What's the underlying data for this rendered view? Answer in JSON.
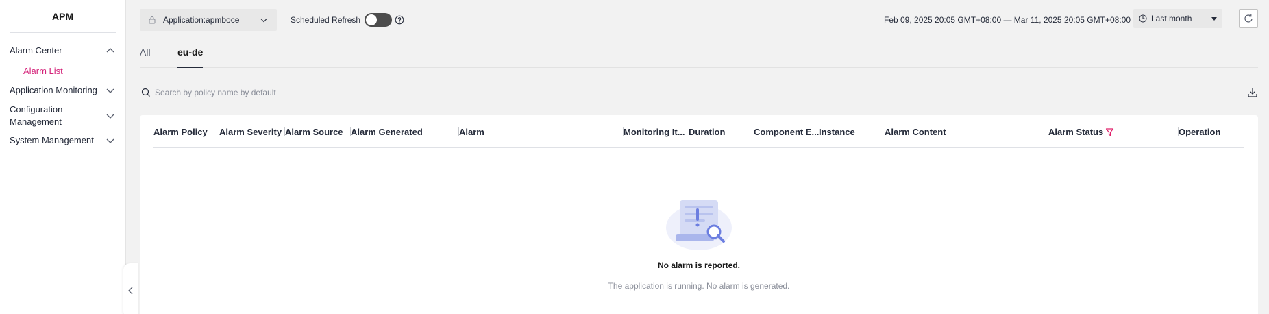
{
  "sidebar": {
    "title": "APM",
    "groups": [
      {
        "label": "Alarm Center",
        "expanded": true,
        "children": [
          "Alarm List"
        ]
      },
      {
        "label": "Application Monitoring",
        "expanded": false
      },
      {
        "label": "Configuration Management",
        "expanded": false
      },
      {
        "label": "System Management",
        "expanded": false
      }
    ]
  },
  "topbar": {
    "application": "Application:apmboce",
    "scheduled_refresh_label": "Scheduled Refresh",
    "scheduled_refresh_on": false,
    "date_range": "Feb 09, 2025 20:05 GMT+08:00 — Mar 11, 2025 20:05 GMT+08:00",
    "period": "Last month"
  },
  "tabs": [
    {
      "label": "All",
      "active": false
    },
    {
      "label": "eu-de",
      "active": true
    }
  ],
  "search": {
    "placeholder": "Search by policy name by default"
  },
  "table": {
    "columns": [
      "Alarm Policy",
      "Alarm Severity",
      "Alarm Source",
      "Alarm Generated",
      "Alarm",
      "Monitoring It...",
      "Duration",
      "Component E...",
      "Instance",
      "Alarm Content",
      "Alarm Status",
      "Operation"
    ]
  },
  "empty": {
    "title": "No alarm is reported.",
    "subtitle": "The application is running. No alarm is generated."
  },
  "colors": {
    "accent": "#d4237a",
    "filter": "#e0206a"
  }
}
